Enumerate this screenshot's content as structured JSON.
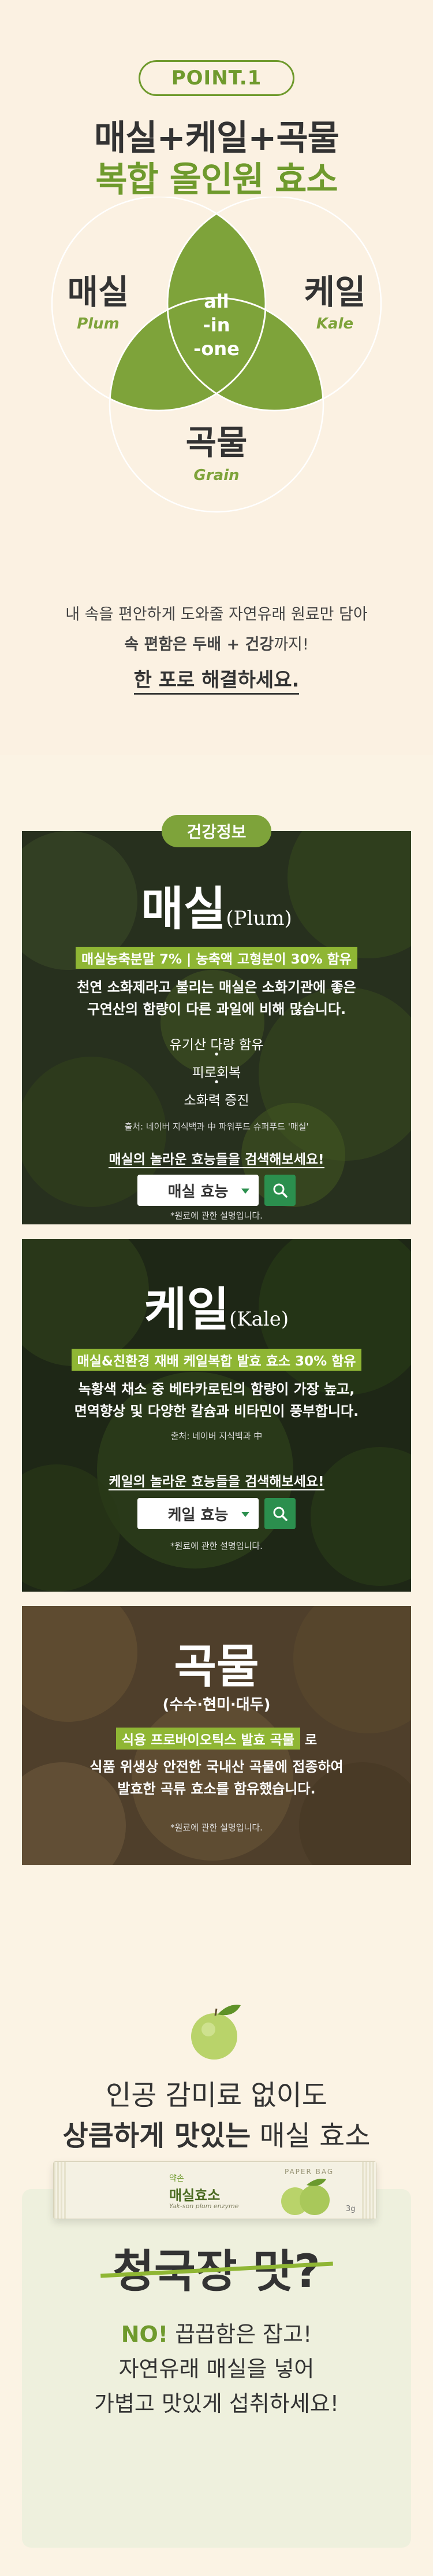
{
  "point": {
    "badge": "POINT.1",
    "title_line1": "매실+케일+곡물",
    "title_line2": "복합 올인원 효소",
    "venn": {
      "plum_ko": "매실",
      "plum_en": "Plum",
      "kale_ko": "케일",
      "kale_en": "Kale",
      "grain_ko": "곡물",
      "grain_en": "Grain",
      "center_1": "all",
      "center_2": "-in",
      "center_3": "-one"
    },
    "desc_line1": "내 속을 편안하게 도와줄 자연유래 원료만 담아",
    "desc_line2_a": "속 편함은 두배 + 건강",
    "desc_line2_b": "까지!",
    "desc_line3": "한 포로 해결하세요."
  },
  "health": {
    "tag": "건강정보",
    "plum": {
      "title": "매실",
      "title_en": "(Plum)",
      "highlight": "매실농축분말 7% | 농축액 고형분이 30% 함유",
      "desc1": "천연 소화제라고 불리는 매실은 소화기관에 좋은",
      "desc2": "구연산의 함량이 다른 과일에 비해 많습니다.",
      "list1": "유기산 다량 함유",
      "list2": "피로회복",
      "list3": "소화력 증진",
      "source": "출처: 네이버 지식백과 中 파워푸드 슈퍼푸드 '매실'",
      "search_text": "매실의 놀라운 효능들을 검색해보세요!",
      "search_keyword": "매실 효능",
      "note": "*원료에 관한 설명입니다."
    },
    "kale": {
      "title": "케일",
      "title_en": "(Kale)",
      "highlight": "매실&친환경 재배 케일복합 발효 효소 30% 함유",
      "desc1": "녹황색 채소 중 베타카로틴의 함량이 가장 높고,",
      "desc2": "면역향상 및 다양한 칼슘과 비타민이 풍부합니다.",
      "source": "출처: 네이버 지식백과 中",
      "search_text": "케일의 놀라운 효능들을 검색해보세요!",
      "search_keyword": "케일 효능",
      "note": "*원료에 관한 설명입니다."
    },
    "grain": {
      "title": "곡물",
      "subtitle": "(수수·현미·대두)",
      "highlight": "식용 프로바이오틱스 발효 곡물",
      "highlight_after": " 로",
      "desc1": "식품 위생상 안전한 국내산 곡물에 접종하여",
      "desc2": "발효한 곡류 효소를 함유했습니다.",
      "note": "*원료에 관한 설명입니다."
    }
  },
  "taste": {
    "line1": "인공 감미료 없이도",
    "line2_bold": "상큼하게 맛있는",
    "line2_rest": " 매실 효소",
    "pack_brand": "PAPER BAG",
    "pack_small": "약손",
    "pack_name": "매실효소",
    "pack_en": "Yak-son plum enzyme",
    "pack_weight": "3g",
    "strike": "청국장 맛?",
    "no": "NO!",
    "no_rest": " 끕끕함은 잡고!",
    "msg2": "자연유래 매실을 넣어",
    "msg3": "가볍고 맛있게 섭취하세요!"
  },
  "colors": {
    "accent": "#6f9a2d",
    "highlight": "#8fb634",
    "search": "#2b8f4e",
    "bg": "#fbf1e2"
  }
}
